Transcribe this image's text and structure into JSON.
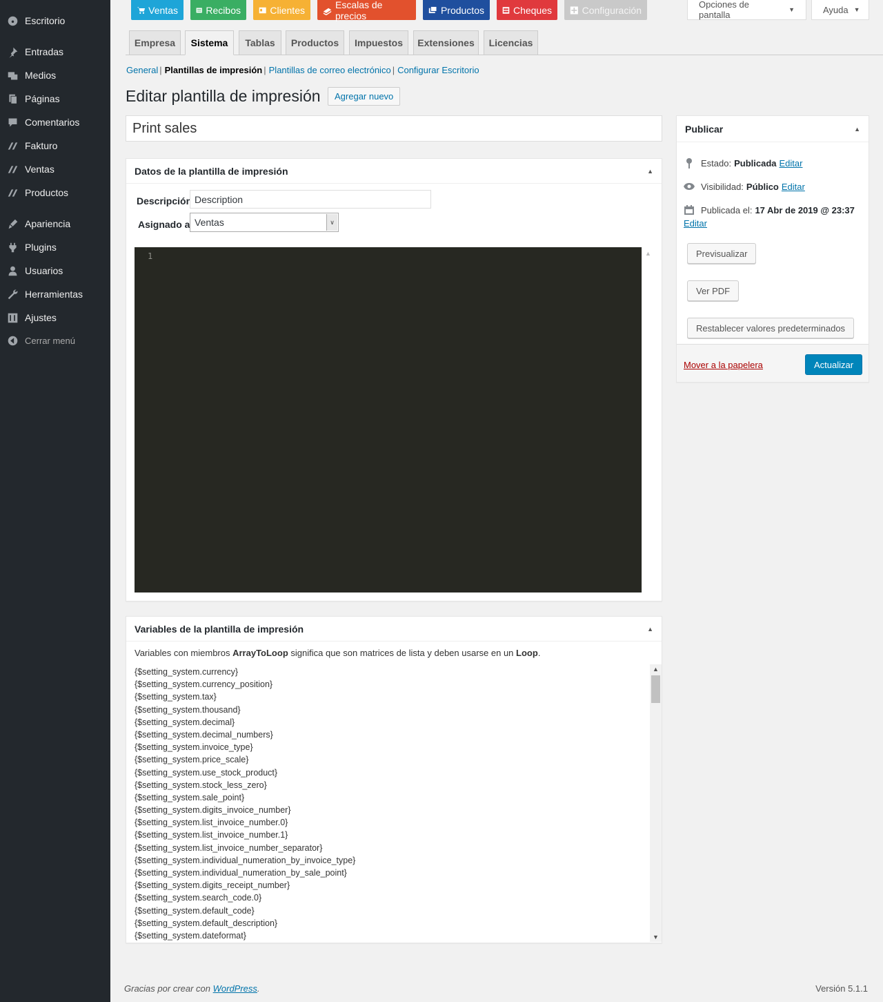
{
  "sidebar": {
    "items": [
      {
        "label": "Escritorio",
        "icon": "dashboard-icon"
      },
      {
        "label": "Entradas",
        "icon": "pin-icon"
      },
      {
        "label": "Medios",
        "icon": "media-icon"
      },
      {
        "label": "Páginas",
        "icon": "pages-icon"
      },
      {
        "label": "Comentarios",
        "icon": "comments-icon"
      },
      {
        "label": "Fakturo",
        "icon": "fakturo-icon"
      },
      {
        "label": "Ventas",
        "icon": "sales-icon"
      },
      {
        "label": "Productos",
        "icon": "products-icon"
      },
      {
        "label": "Apariencia",
        "icon": "appearance-icon"
      },
      {
        "label": "Plugins",
        "icon": "plugins-icon"
      },
      {
        "label": "Usuarios",
        "icon": "users-icon"
      },
      {
        "label": "Herramientas",
        "icon": "tools-icon"
      },
      {
        "label": "Ajustes",
        "icon": "settings-icon"
      }
    ],
    "collapse_label": "Cerrar menú"
  },
  "topbar": {
    "buttons": [
      {
        "label": "Ventas",
        "color": "#1ea5d8"
      },
      {
        "label": "Recibos",
        "color": "#3aae63"
      },
      {
        "label": "Clientes",
        "color": "#f6b134"
      },
      {
        "label": "Escalas de precios",
        "color": "#e2512d"
      },
      {
        "label": "Productos",
        "color": "#1f4f9e"
      },
      {
        "label": "Cheques",
        "color": "#e0393d"
      },
      {
        "label": "Configuración",
        "color": "#c9c9c9"
      }
    ],
    "screen_options": "Opciones de pantalla",
    "help": "Ayuda"
  },
  "tabs": [
    "Empresa",
    "Sistema",
    "Tablas",
    "Productos",
    "Impuestos",
    "Extensiones",
    "Licencias"
  ],
  "active_tab": "Sistema",
  "subnav": {
    "general": "General",
    "print_templates": "Plantillas de impresión",
    "email_templates": "Plantillas de correo electrónico",
    "configure_dashboard": "Configurar Escritorio"
  },
  "page": {
    "title": "Editar plantilla de impresión",
    "add_new": "Agregar nuevo",
    "post_title": "Print sales"
  },
  "template_data": {
    "heading": "Datos de la plantilla de impresión",
    "description_label": "Descripción",
    "description_value": "Description",
    "assigned_label": "Asignado a",
    "assigned_value": "Ventas",
    "editor_line": "1"
  },
  "variables": {
    "heading": "Variables de la plantilla de impresión",
    "intro_pre": "Variables con miembros",
    "intro_bold1": "ArrayToLoop",
    "intro_mid": "significa que son matrices de lista y deben usarse en un",
    "intro_bold2": "Loop",
    "intro_end": ".",
    "items": [
      "{$setting_system.currency}",
      "{$setting_system.currency_position}",
      "{$setting_system.tax}",
      "{$setting_system.thousand}",
      "{$setting_system.decimal}",
      "{$setting_system.decimal_numbers}",
      "{$setting_system.invoice_type}",
      "{$setting_system.price_scale}",
      "{$setting_system.use_stock_product}",
      "{$setting_system.stock_less_zero}",
      "{$setting_system.sale_point}",
      "{$setting_system.digits_invoice_number}",
      "{$setting_system.list_invoice_number.0}",
      "{$setting_system.list_invoice_number.1}",
      "{$setting_system.list_invoice_number_separator}",
      "{$setting_system.individual_numeration_by_invoice_type}",
      "{$setting_system.individual_numeration_by_sale_point}",
      "{$setting_system.digits_receipt_number}",
      "{$setting_system.search_code.0}",
      "{$setting_system.default_code}",
      "{$setting_system.default_description}",
      "{$setting_system.dateformat}"
    ]
  },
  "publish": {
    "heading": "Publicar",
    "status_label": "Estado:",
    "status_value": "Publicada",
    "visibility_label": "Visibilidad:",
    "visibility_value": "Público",
    "published_label": "Publicada el:",
    "published_value": "17 Abr de 2019 @ 23:37",
    "edit": "Editar",
    "preview": "Previsualizar",
    "view_pdf": "Ver PDF",
    "reset": "Restablecer valores predeterminados",
    "trash": "Mover a la papelera",
    "update": "Actualizar"
  },
  "footer": {
    "thanks_pre": "Gracias por crear con",
    "wordpress": "WordPress",
    "thanks_end": ".",
    "version": "Versión 5.1.1"
  }
}
